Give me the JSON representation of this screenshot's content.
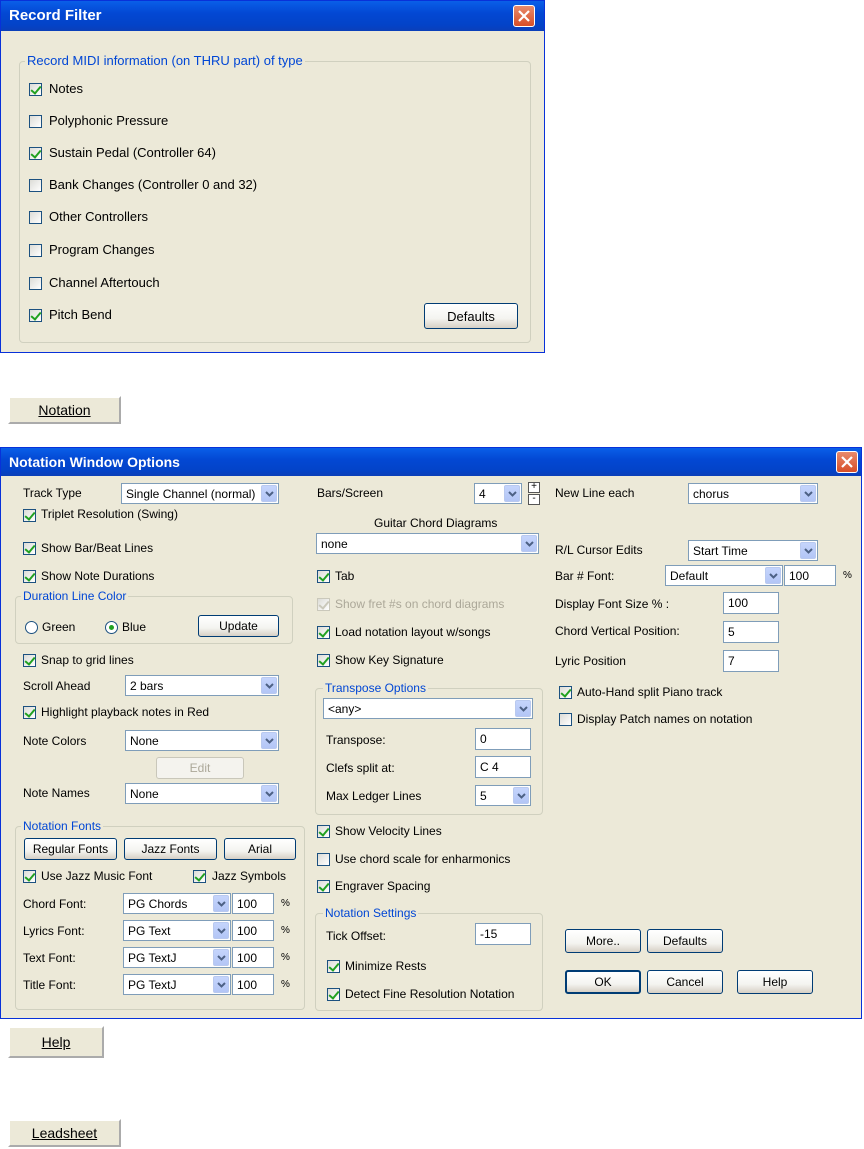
{
  "record_filter": {
    "title": "Record Filter",
    "group_label": "Record MIDI information (on THRU part) of type",
    "items": [
      {
        "label": "Notes",
        "checked": true
      },
      {
        "label": "Polyphonic Pressure",
        "checked": false
      },
      {
        "label": "Sustain Pedal (Controller 64)",
        "checked": true
      },
      {
        "label": "Bank Changes (Controller 0 and 32)",
        "checked": false
      },
      {
        "label": "Other Controllers",
        "checked": false
      },
      {
        "label": "Program Changes",
        "checked": false
      },
      {
        "label": "Channel Aftertouch",
        "checked": false
      },
      {
        "label": "Pitch Bend",
        "checked": true
      }
    ],
    "defaults_button": "Defaults"
  },
  "notation_button": "Notation",
  "notation_options": {
    "title": "Notation Window Options",
    "track_type_label": "Track Type",
    "track_type_value": "Single Channel (normal)",
    "triplet_resolution": "Triplet Resolution (Swing)",
    "show_bar_beat_lines": "Show Bar/Beat Lines",
    "show_note_durations": "Show Note Durations",
    "duration_line_color": "Duration Line Color",
    "green_label": "Green",
    "blue_label": "Blue",
    "update_button": "Update",
    "snap_to_grid": "Snap to grid lines",
    "scroll_ahead_label": "Scroll Ahead",
    "scroll_ahead_value": "2 bars",
    "highlight_playback": "Highlight playback notes in Red",
    "note_colors_label": "Note Colors",
    "note_colors_value": "None",
    "edit_button": "Edit",
    "note_names_label": "Note Names",
    "note_names_value": "None",
    "notation_fonts_label": "Notation Fonts",
    "regular_fonts_button": "Regular Fonts",
    "jazz_fonts_button": "Jazz Fonts",
    "arial_button": "Arial",
    "use_jazz_music_font": "Use Jazz Music Font",
    "jazz_symbols": "Jazz Symbols",
    "fonts": [
      {
        "label": "Chord Font:",
        "value": "PG Chords",
        "size": "100"
      },
      {
        "label": "Lyrics Font:",
        "value": "PG Text",
        "size": "100"
      },
      {
        "label": "Text Font:",
        "value": "PG TextJ",
        "size": "100"
      },
      {
        "label": "Title Font:",
        "value": "PG TextJ",
        "size": "100"
      }
    ],
    "percent": "%",
    "bars_screen_label": "Bars/Screen",
    "bars_screen_value": "4",
    "spin_up": "+",
    "spin_down": "-",
    "guitar_chord_diagrams_label": "Guitar Chord Diagrams",
    "guitar_chord_value": "none",
    "tab_label": "Tab",
    "show_fret": "Show fret #s on chord diagrams",
    "load_notation_layout": "Load notation layout w/songs",
    "show_key_signature": "Show Key Signature",
    "transpose_options_label": "Transpose Options",
    "transpose_options_value": "<any>",
    "transpose_label": "Transpose:",
    "transpose_value": "0",
    "clefs_split_label": "Clefs split at:",
    "clefs_split_value": "C 4",
    "max_ledger_label": "Max Ledger Lines",
    "max_ledger_value": "5",
    "show_velocity_lines": "Show Velocity Lines",
    "use_chord_scale": "Use chord scale for enharmonics",
    "engraver_spacing": "Engraver Spacing",
    "notation_settings_label": "Notation Settings",
    "tick_offset_label": "Tick Offset:",
    "tick_offset_value": "-15",
    "minimize_rests": "Minimize Rests",
    "detect_fine_resolution": "Detect Fine Resolution Notation",
    "new_line_each_label": "New Line each",
    "new_line_each_value": "chorus",
    "rl_cursor_label": "R/L Cursor Edits",
    "rl_cursor_value": "Start Time",
    "bar_font_label": "Bar # Font:",
    "bar_font_value": "Default",
    "bar_font_size": "100",
    "display_font_size_label": "Display Font Size % :",
    "display_font_size_value": "100",
    "chord_vertical_label": "Chord Vertical Position:",
    "chord_vertical_value": "5",
    "lyric_position_label": "Lyric Position",
    "lyric_position_value": "7",
    "auto_hand_split": "Auto-Hand split Piano track",
    "display_patch_names": "Display Patch names on notation",
    "more_button": "More..",
    "defaults_button": "Defaults",
    "ok_button": "OK",
    "cancel_button": "Cancel",
    "help_button": "Help"
  },
  "help_button": "Help",
  "leadsheet_button": "Leadsheet",
  "colors": {
    "title_blue": "#0348d4",
    "dialog_bg": "#ece9d8",
    "group_label": "#0046d5",
    "close_red": "#d84e27",
    "check_green": "#21a121"
  }
}
